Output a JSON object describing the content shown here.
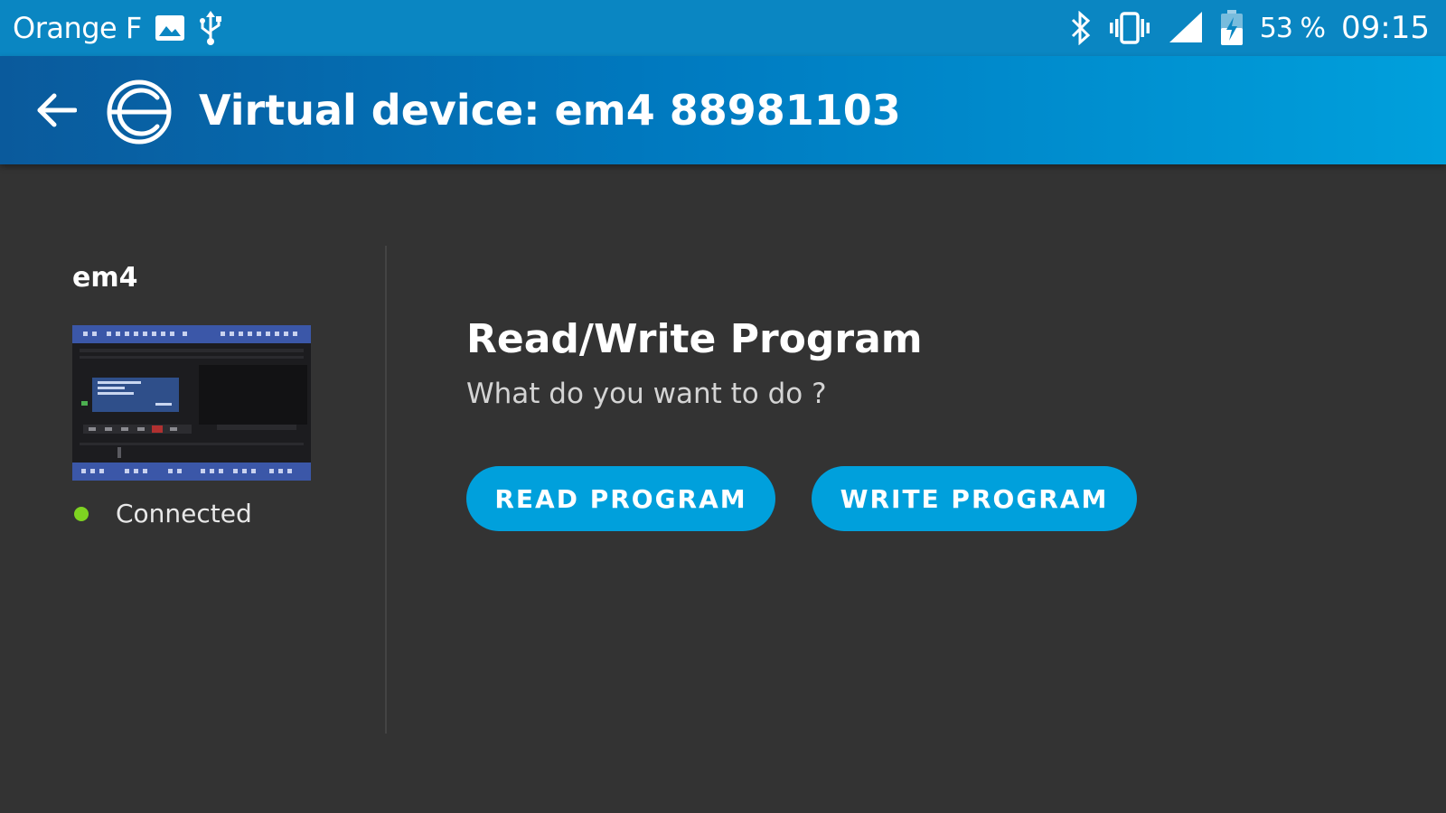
{
  "status_bar": {
    "carrier": "Orange F",
    "battery_percent": "53 %",
    "time": "09:15",
    "icons": [
      "image-notification-icon",
      "usb-icon",
      "bluetooth-icon",
      "vibrate-icon",
      "signal-icon",
      "battery-charging-icon"
    ]
  },
  "app_bar": {
    "title": "Virtual device: em4 88981103",
    "back_icon": "arrow-left-icon",
    "logo_icon": "app-logo-icon"
  },
  "device": {
    "name": "em4",
    "status": "Connected",
    "status_color": "#7ed321"
  },
  "main": {
    "title": "Read/Write Program",
    "subtitle": "What do you want to do ?",
    "read_button": "READ PROGRAM",
    "write_button": "WRITE PROGRAM"
  },
  "colors": {
    "status_bar": "#0a86c2",
    "app_bar_start": "#0a5a9c",
    "app_bar_end": "#00a0dc",
    "background": "#333333",
    "accent": "#00a0dc"
  }
}
